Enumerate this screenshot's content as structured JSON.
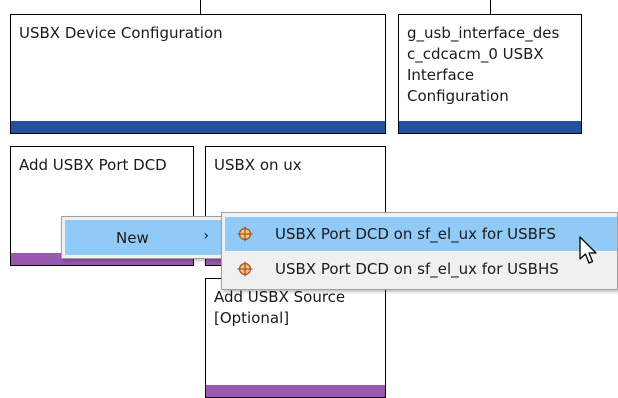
{
  "blocks": {
    "device_config": {
      "title": "USBX Device Configuration"
    },
    "interface_config": {
      "title": "g_usb_interface_des\nc_cdcacm_0 USBX\nInterface\nConfiguration"
    },
    "port_dcd": {
      "title": "Add USBX Port DCD"
    },
    "usbx_on_ux": {
      "title": "USBX on ux"
    },
    "source": {
      "title": "Add USBX Source\n[Optional]"
    }
  },
  "context_menu": {
    "new_label": "New",
    "arrow": "›"
  },
  "submenu": {
    "items": [
      {
        "label": "USBX Port DCD on sf_el_ux for USBFS",
        "icon": "crosshair-module-icon",
        "highlighted": true
      },
      {
        "label": "USBX Port DCD on sf_el_ux for USBHS",
        "icon": "crosshair-module-icon",
        "highlighted": false
      }
    ]
  },
  "colors": {
    "config_bar": "#24509e",
    "module_bar": "#9a58b0",
    "menu_highlight": "#91c9f7",
    "menu_background": "#f0f0f0"
  }
}
